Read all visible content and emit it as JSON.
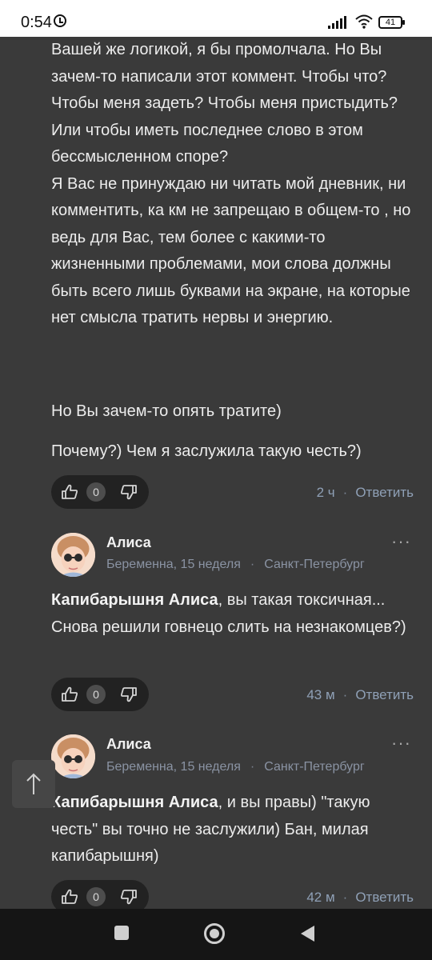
{
  "status_bar": {
    "time": "0:54",
    "battery": "41",
    "icons": [
      "alarm-icon",
      "signal-icon",
      "wifi-icon",
      "battery-icon"
    ]
  },
  "post": {
    "paragraphs": [
      "Вашей же логикой, я бы промолчала. Но Вы зачем-то написали этот коммент. Чтобы что? Чтобы меня задеть? Чтобы меня пристыдить? Или чтобы иметь последнее слово в этом бессмысленном споре?\nЯ Вас не принуждаю ни читать мой дневник, ни комментить, ка км не запрещаю в общем-то , но ведь для Вас, тем более с какими-то жизненными проблемами, мои слова должны быть всего лишь буквами на экране, на которые нет смысла тратить нервы и энергию.",
      "Но Вы зачем-то опять тратите)",
      "Почему?) Чем я заслужила такую честь?)"
    ],
    "likes": "0",
    "time": "2 ч",
    "reply": "Ответить"
  },
  "comments": [
    {
      "author": "Алиса",
      "status": "Беременна, 15 неделя",
      "city": "Санкт-Петербург",
      "more": "···",
      "mention": "Капибарышня Алиса",
      "text": ", вы такая токсичная... Снова решили говнецо слить на незнакомцев?)",
      "likes": "0",
      "time": "43 м",
      "reply": "Ответить"
    },
    {
      "author": "Алиса",
      "status": "Беременна, 15 неделя",
      "city": "Санкт-Петербург",
      "more": "···",
      "mention": "Капибарышня Алиса",
      "text": ", и вы правы) \"такую честь\" вы точно не заслужили) Бан, милая капибарышня)",
      "likes": "0",
      "time": "42 м",
      "reply": "Ответить"
    }
  ],
  "scroll_top": {
    "icon": "arrow-up-icon",
    "glyph": "↑"
  },
  "colors": {
    "background": "#3a3a3a",
    "meta": "#8fa0b6",
    "pill": "#222222"
  }
}
